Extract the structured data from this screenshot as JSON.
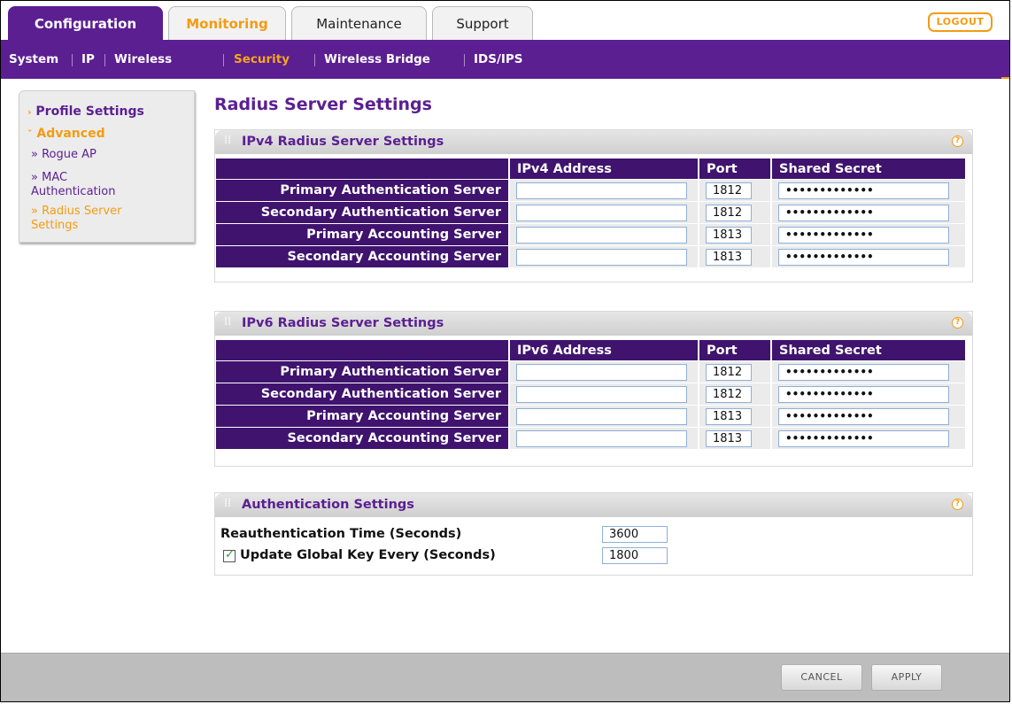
{
  "tabs": [
    {
      "label": "Configuration",
      "state": "active"
    },
    {
      "label": "Monitoring",
      "state": "highlight"
    },
    {
      "label": "Maintenance",
      "state": "normal"
    },
    {
      "label": "Support",
      "state": "normal"
    }
  ],
  "logout_label": "LOGOUT",
  "subnav": [
    "System",
    "IP",
    "Wireless",
    "Security",
    "Wireless Bridge",
    "IDS/IPS"
  ],
  "subnav_active": "Security",
  "sidebar": {
    "profile": "Profile Settings",
    "advanced": "Advanced",
    "rogue": "Rogue AP",
    "mac_1": "MAC",
    "mac_2": "Authentication",
    "radius_1": "Radius Server",
    "radius_2": "Settings"
  },
  "page_title": "Radius Server Settings",
  "ipv4": {
    "title": "IPv4 Radius Server Settings",
    "headers": [
      "IPv4 Address",
      "Port",
      "Shared Secret"
    ],
    "rows": [
      {
        "label": "Primary Authentication Server",
        "address": "",
        "port": "1812",
        "secret": "•••••••••••••"
      },
      {
        "label": "Secondary Authentication Server",
        "address": "",
        "port": "1812",
        "secret": "•••••••••••••"
      },
      {
        "label": "Primary Accounting Server",
        "address": "",
        "port": "1813",
        "secret": "•••••••••••••"
      },
      {
        "label": "Secondary Accounting Server",
        "address": "",
        "port": "1813",
        "secret": "•••••••••••••"
      }
    ]
  },
  "ipv6": {
    "title": "IPv6 Radius Server Settings",
    "headers": [
      "IPv6 Address",
      "Port",
      "Shared Secret"
    ],
    "rows": [
      {
        "label": "Primary Authentication Server",
        "address": "",
        "port": "1812",
        "secret": "•••••••••••••"
      },
      {
        "label": "Secondary Authentication Server",
        "address": "",
        "port": "1812",
        "secret": "•••••••••••••"
      },
      {
        "label": "Primary Accounting Server",
        "address": "",
        "port": "1813",
        "secret": "•••••••••••••"
      },
      {
        "label": "Secondary Accounting Server",
        "address": "",
        "port": "1813",
        "secret": "•••••••••••••"
      }
    ]
  },
  "auth": {
    "title": "Authentication Settings",
    "reauth_label": "Reauthentication Time (Seconds)",
    "reauth_value": "3600",
    "global_key_label": "Update Global Key Every (Seconds)",
    "global_key_value": "1800",
    "global_key_checked": true
  },
  "buttons": {
    "cancel": "CANCEL",
    "apply": "APPLY"
  },
  "colors": {
    "primary": "#5b1f91",
    "header_dark": "#3f136e",
    "accent": "#f39c11"
  }
}
